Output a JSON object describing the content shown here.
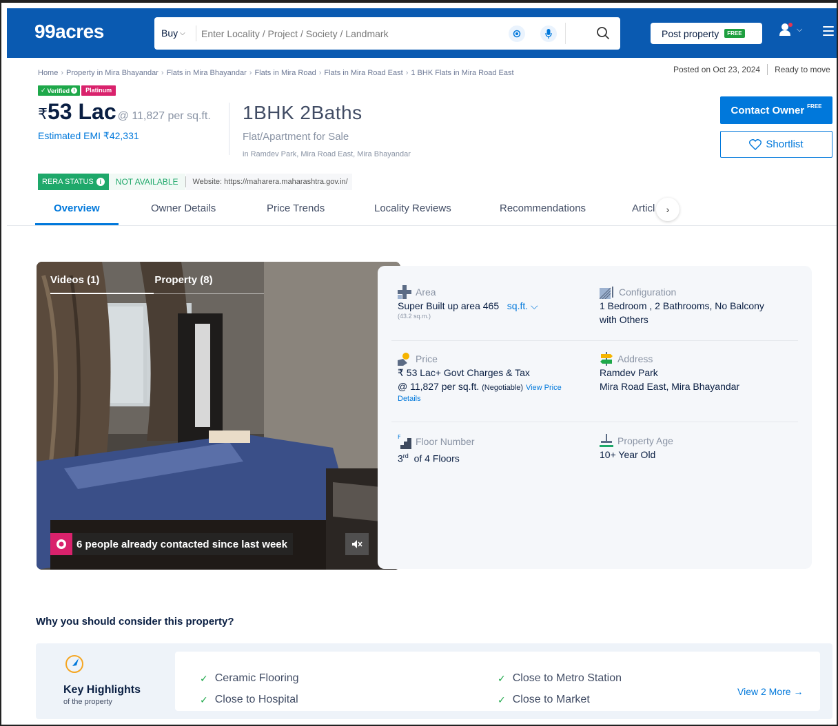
{
  "header": {
    "logo": "99acres",
    "search_type": "Buy",
    "search_placeholder": "Enter Locality / Project / Society / Landmark",
    "post_label": "Post property",
    "post_badge": "FREE"
  },
  "breadcrumb": [
    "Home",
    "Property in Mira Bhayandar",
    "Flats in Mira Bhayandar",
    "Flats in Mira Road",
    "Flats in Mira Road East",
    "1 BHK Flats in Mira Road East"
  ],
  "posted": "Posted on Oct 23, 2024",
  "ready": "Ready to move",
  "badges": {
    "verified": "Verified",
    "platinum": "Platinum"
  },
  "price": {
    "currency": "₹",
    "amount": "53 Lac",
    "per_sqft": "@ 11,827 per sq.ft.",
    "emi": "Estimated EMI ₹42,331"
  },
  "property": {
    "title": "1BHK 2Baths",
    "type": "Flat/Apartment for Sale",
    "location": "in Ramdev Park, Mira Road East, Mira Bhayandar"
  },
  "actions": {
    "contact": "Contact Owner",
    "contact_badge": "FREE",
    "shortlist": "Shortlist"
  },
  "rera": {
    "label": "RERA STATUS",
    "value": "NOT AVAILABLE",
    "website": "Website: https://maharera.maharashtra.gov.in/"
  },
  "tabs": [
    "Overview",
    "Owner Details",
    "Price Trends",
    "Locality Reviews",
    "Recommendations",
    "Articl"
  ],
  "media": {
    "videos": "Videos (1)",
    "photos": "Property (8)",
    "contacted": "6 people already contacted since last week"
  },
  "details": {
    "area": {
      "label": "Area",
      "value": "Super Built up area 465",
      "unit": "sq.ft.",
      "sub": "(43.2 sq.m.)"
    },
    "config": {
      "label": "Configuration",
      "line1": "1 Bedroom , 2 Bathrooms, No Balcony",
      "line2": "with Others"
    },
    "price": {
      "label": "Price",
      "line1": "₹ 53 Lac+ Govt Charges & Tax",
      "line2": "@ 11,827 per sq.ft.",
      "neg": "(Negotiable)",
      "link1": "View Price",
      "link2": "Details"
    },
    "address": {
      "label": "Address",
      "line1": "Ramdev Park",
      "line2": "Mira Road East, Mira Bhayandar"
    },
    "floor": {
      "label": "Floor Number",
      "num": "3",
      "sup": "rd",
      "rest": "of 4 Floors"
    },
    "age": {
      "label": "Property Age",
      "value": "10+ Year Old"
    }
  },
  "why": {
    "title": "Why you should consider this property?",
    "kh_title": "Key Highlights",
    "kh_sub": "of the property",
    "items": [
      "Ceramic Flooring",
      "Close to Metro Station",
      "Close to Hospital",
      "Close to Market"
    ],
    "more": "View 2 More →"
  },
  "colors": {
    "brand": "#0a5ab1",
    "accent": "#0078db",
    "green": "#1ea84a",
    "pink": "#d9226c"
  }
}
